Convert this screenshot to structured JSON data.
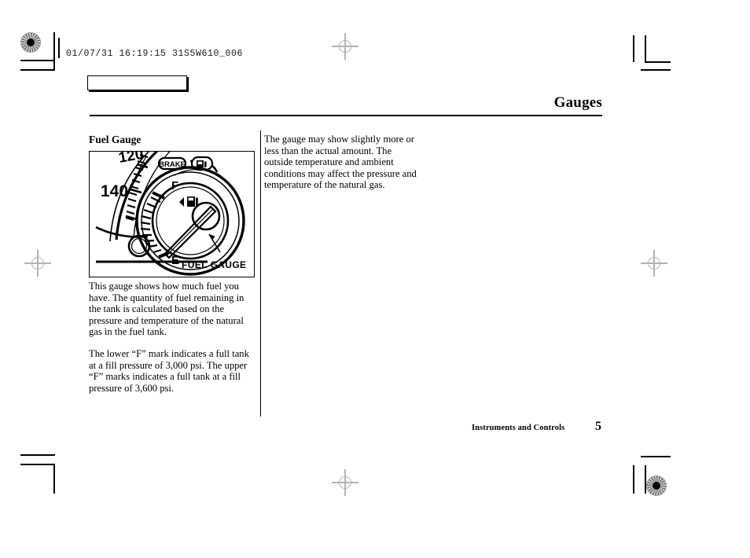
{
  "scan": {
    "header_stamp": "01/07/31 16:19:15 31S5W610_006"
  },
  "page": {
    "title": "Gauges",
    "footer_section": "Instruments and Controls",
    "page_number": "5"
  },
  "left_column": {
    "heading": "Fuel Gauge",
    "paragraph_1": "This gauge shows how much fuel you have. The quantity of fuel remaining in the tank is calculated based on the pressure and temperature of the natural gas in the fuel tank.",
    "paragraph_2": "The lower “F” mark indicates a full tank at a fill pressure of 3,000 psi. The upper “F” marks indicates a full tank at a fill pressure of 3,600 psi."
  },
  "right_column": {
    "paragraph_1": "The gauge may show slightly more or less than the actual amount. The outside temperature and ambient conditions may affect the pressure and temperature of the natural gas."
  },
  "figure": {
    "caption": "FUEL GAUGE",
    "speedometer_labels": [
      "120",
      "140"
    ],
    "warning_lights": [
      "BRAKE",
      "low-fuel-icon"
    ],
    "gauge_marks": {
      "full": "F",
      "empty": "E"
    }
  },
  "colors": {
    "ink": "#000000",
    "paper": "#ffffff",
    "registration": "#b4b4b4"
  }
}
